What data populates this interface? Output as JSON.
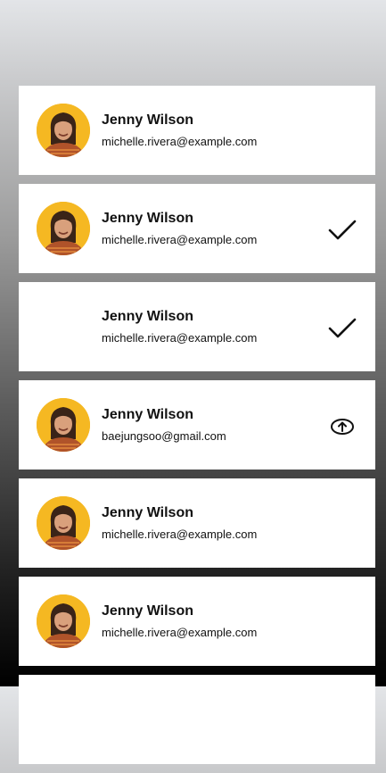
{
  "contacts": [
    {
      "name": "Jenny Wilson",
      "email": "michelle.rivera@example.com",
      "show_avatar": true,
      "action_icon": ""
    },
    {
      "name": "Jenny Wilson",
      "email": "michelle.rivera@example.com",
      "show_avatar": true,
      "action_icon": "check-icon"
    },
    {
      "name": "Jenny Wilson",
      "email": "michelle.rivera@example.com",
      "show_avatar": false,
      "action_icon": "check-icon"
    },
    {
      "name": "Jenny Wilson",
      "email": "baejungsoo@gmail.com",
      "show_avatar": true,
      "action_icon": "upload-icon"
    },
    {
      "name": "Jenny Wilson",
      "email": "michelle.rivera@example.com",
      "show_avatar": true,
      "action_icon": ""
    },
    {
      "name": "Jenny Wilson",
      "email": "michelle.rivera@example.com",
      "show_avatar": true,
      "action_icon": ""
    },
    {
      "name": "",
      "email": "",
      "show_avatar": false,
      "action_icon": ""
    }
  ],
  "colors": {
    "avatar_bg": "#f5b822",
    "text": "#111111",
    "card_bg": "#ffffff"
  }
}
